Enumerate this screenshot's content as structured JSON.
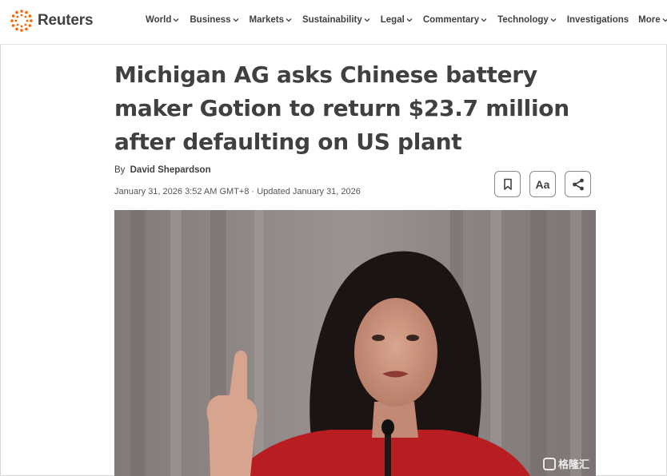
{
  "brand": {
    "name": "Reuters"
  },
  "nav": {
    "items": [
      {
        "label": "World",
        "has_dropdown": true
      },
      {
        "label": "Business",
        "has_dropdown": true
      },
      {
        "label": "Markets",
        "has_dropdown": true
      },
      {
        "label": "Sustainability",
        "has_dropdown": true
      },
      {
        "label": "Legal",
        "has_dropdown": true
      },
      {
        "label": "Commentary",
        "has_dropdown": true
      },
      {
        "label": "Technology",
        "has_dropdown": true
      },
      {
        "label": "Investigations",
        "has_dropdown": false
      },
      {
        "label": "More",
        "has_dropdown": true
      }
    ]
  },
  "article": {
    "headline": "Michigan AG asks Chinese battery maker Gotion to return $23.7 million after defaulting on US plant",
    "byline_prefix": "By",
    "author": "David Shepardson",
    "dateline": "January 31, 2026 3:52 AM GMT+8 · Updated January 31, 2026"
  },
  "tools": {
    "bookmark_icon": "bookmark-icon",
    "text_size_label": "Aa",
    "share_icon": "share-icon"
  },
  "photo": {
    "subject": "woman with dark hair in red jacket raising index finger at a microphone",
    "background_color": "#8a8380"
  },
  "watermark": {
    "text": "格隆汇"
  },
  "colors": {
    "text": "#404040",
    "accent_orange": "#fa6400"
  }
}
